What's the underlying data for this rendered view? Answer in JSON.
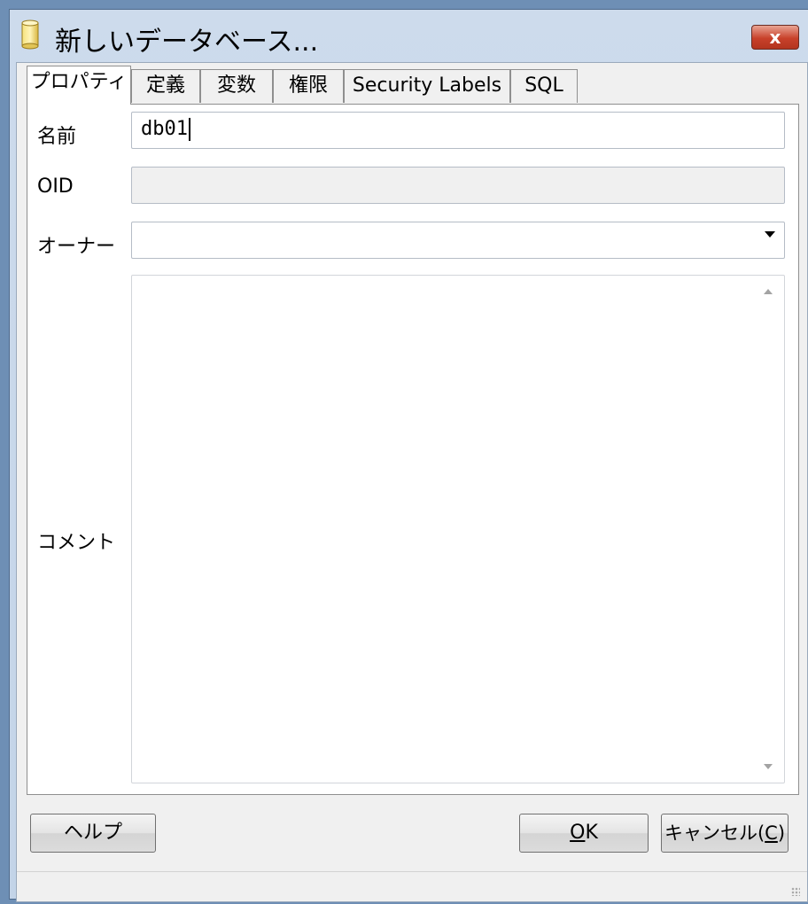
{
  "window": {
    "title": "新しいデータベース...",
    "close_label": "x",
    "icon": "database-icon"
  },
  "tabs": [
    {
      "label": "プロパティ",
      "active": true
    },
    {
      "label": "定義",
      "active": false
    },
    {
      "label": "変数",
      "active": false
    },
    {
      "label": "権限",
      "active": false
    },
    {
      "label": "Security Labels",
      "active": false
    },
    {
      "label": "SQL",
      "active": false
    }
  ],
  "properties": {
    "name_label": "名前",
    "name_value": "db01",
    "oid_label": "OID",
    "oid_value": "",
    "owner_label": "オーナー",
    "owner_value": "",
    "comment_label": "コメント",
    "comment_value": ""
  },
  "buttons": {
    "help": "ヘルプ",
    "ok_mnemonic": "O",
    "ok_rest": "K",
    "cancel_prefix": "キャンセル(",
    "cancel_mnemonic": "C",
    "cancel_suffix": ")"
  },
  "colors": {
    "title_bar": "#c3d4e8",
    "close_button": "#c8412a",
    "dialog_bg": "#f0f0f0"
  }
}
